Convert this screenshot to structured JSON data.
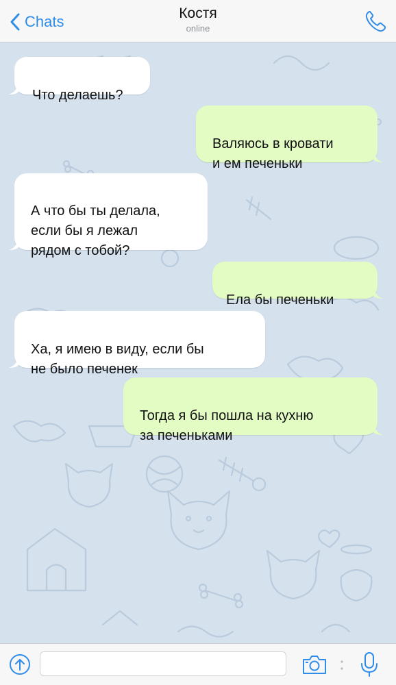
{
  "header": {
    "back_label": "Chats",
    "contact_name": "Костя",
    "status": "online"
  },
  "colors": {
    "accent": "#2f8ce8",
    "incoming_bubble": "#ffffff",
    "outgoing_bubble": "#e2fcc4",
    "chat_background": "#d5e1ed"
  },
  "icons": {
    "back": "chevron-left-icon",
    "call": "phone-icon",
    "attach": "attach-arrow-icon",
    "camera": "camera-icon",
    "mic": "microphone-icon"
  },
  "messages": [
    {
      "direction": "incoming",
      "text": "Что делаешь?"
    },
    {
      "direction": "outgoing",
      "text": "Валяюсь в кровати\nи ем печеньки"
    },
    {
      "direction": "incoming",
      "text": "А что бы ты делала,\nесли бы я лежал\nрядом с тобой?"
    },
    {
      "direction": "outgoing",
      "text": "Ела бы печеньки"
    },
    {
      "direction": "incoming",
      "text": "Ха, я имею в виду, если бы\nне было печенек"
    },
    {
      "direction": "outgoing",
      "text": "Тогда я бы пошла на кухню\nза печеньками"
    }
  ],
  "composer": {
    "value": "",
    "placeholder": ""
  }
}
